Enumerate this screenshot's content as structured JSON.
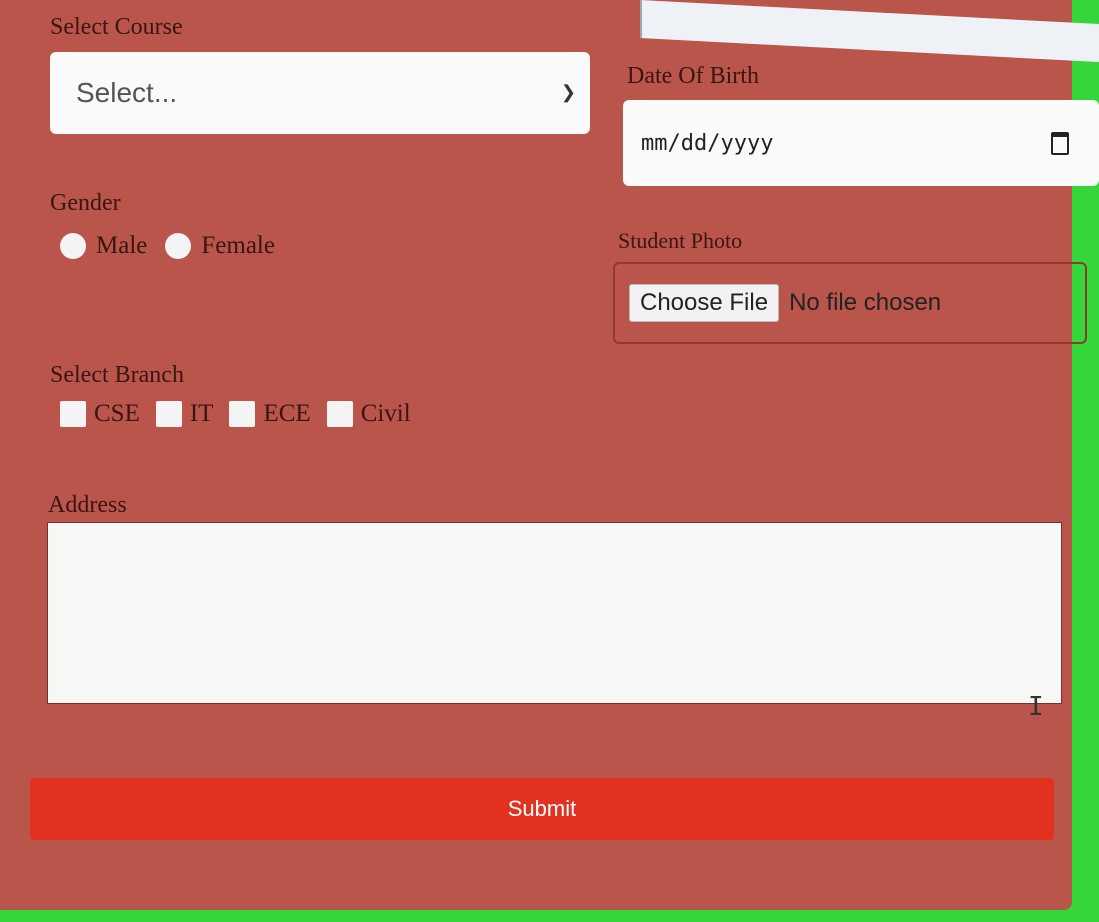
{
  "form": {
    "course_label": "Select Course",
    "course_value": "Select...",
    "dob_label": "Date Of Birth",
    "dob_value": "mm/dd/yyyy",
    "gender_label": "Gender",
    "gender_options": [
      "Male",
      "Female"
    ],
    "photo_label": "Student Photo",
    "photo_button": "Choose File",
    "photo_status": "No file chosen",
    "branch_label": "Select Branch",
    "branch_options": [
      "CSE",
      "IT",
      "ECE",
      "Civil"
    ],
    "address_label": "Address",
    "address_value": "",
    "submit_label": "Submit"
  },
  "colors": {
    "background": "#34d63a",
    "panel": "#b9554a",
    "submit": "#e2311e"
  }
}
